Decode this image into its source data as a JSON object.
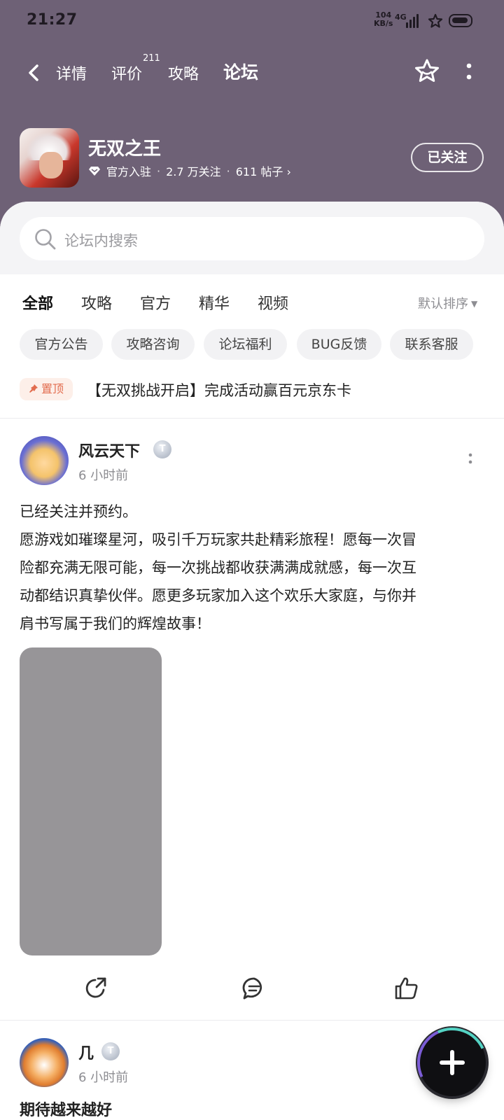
{
  "status_bar": {
    "time": "21:27",
    "speed_value": "104",
    "speed_unit": "KB/s",
    "network": "4G"
  },
  "nav": {
    "tabs": [
      {
        "label": "详情"
      },
      {
        "label": "评价"
      },
      {
        "label": "攻略"
      },
      {
        "label": "论坛"
      }
    ],
    "active_tab": "论坛",
    "review_count_badge": "211"
  },
  "app": {
    "name": "无双之王",
    "official": "官方入驻",
    "followers": "2.7 万关注",
    "posts": "611 帖子",
    "posts_chevron": "›",
    "follow_button": "已关注"
  },
  "search": {
    "placeholder": "论坛内搜索"
  },
  "filter_tabs": [
    {
      "label": "全部"
    },
    {
      "label": "攻略"
    },
    {
      "label": "官方"
    },
    {
      "label": "精华"
    },
    {
      "label": "视频"
    }
  ],
  "active_filter": "全部",
  "sort_label": "默认排序",
  "chips": [
    {
      "label": "官方公告"
    },
    {
      "label": "攻略咨询"
    },
    {
      "label": "论坛福利"
    },
    {
      "label": "BUG反馈"
    },
    {
      "label": "联系客服"
    }
  ],
  "pinned": {
    "tag": "置顶",
    "title": "【无双挑战开启】完成活动赢百元京东卡"
  },
  "posts": [
    {
      "username": "风云天下",
      "level": "T",
      "time": "6 小时前",
      "content_lines": [
        "已经关注并预约。",
        "愿游戏如璀璨星河，吸引千万玩家共赴精彩旅程！愿每一次冒",
        "险都充满无限可能，每一次挑战都收获满满成就感，每一次互",
        "动都结识真挚伙伴。愿更多玩家加入这个欢乐大家庭，与你并",
        "肩书写属于我们的辉煌故事！"
      ]
    },
    {
      "username": "几",
      "level": "T",
      "time": "6 小时前",
      "content_lines": [
        "期待越来越好"
      ]
    }
  ],
  "colors": {
    "header_bg": "#6e6176",
    "accent": "#5ecfc0",
    "pin_tag_text": "#e26c4e",
    "pin_tag_bg": "#fdefe9"
  },
  "icons": {
    "back": "chevron-left-icon",
    "favorite": "star-icon",
    "more": "more-vertical-icon",
    "official": "diamond-icon",
    "search": "search-icon",
    "pin": "pin-icon",
    "share": "share-icon",
    "comment": "comment-icon",
    "like": "thumbs-up-icon",
    "compose": "plus-icon"
  }
}
